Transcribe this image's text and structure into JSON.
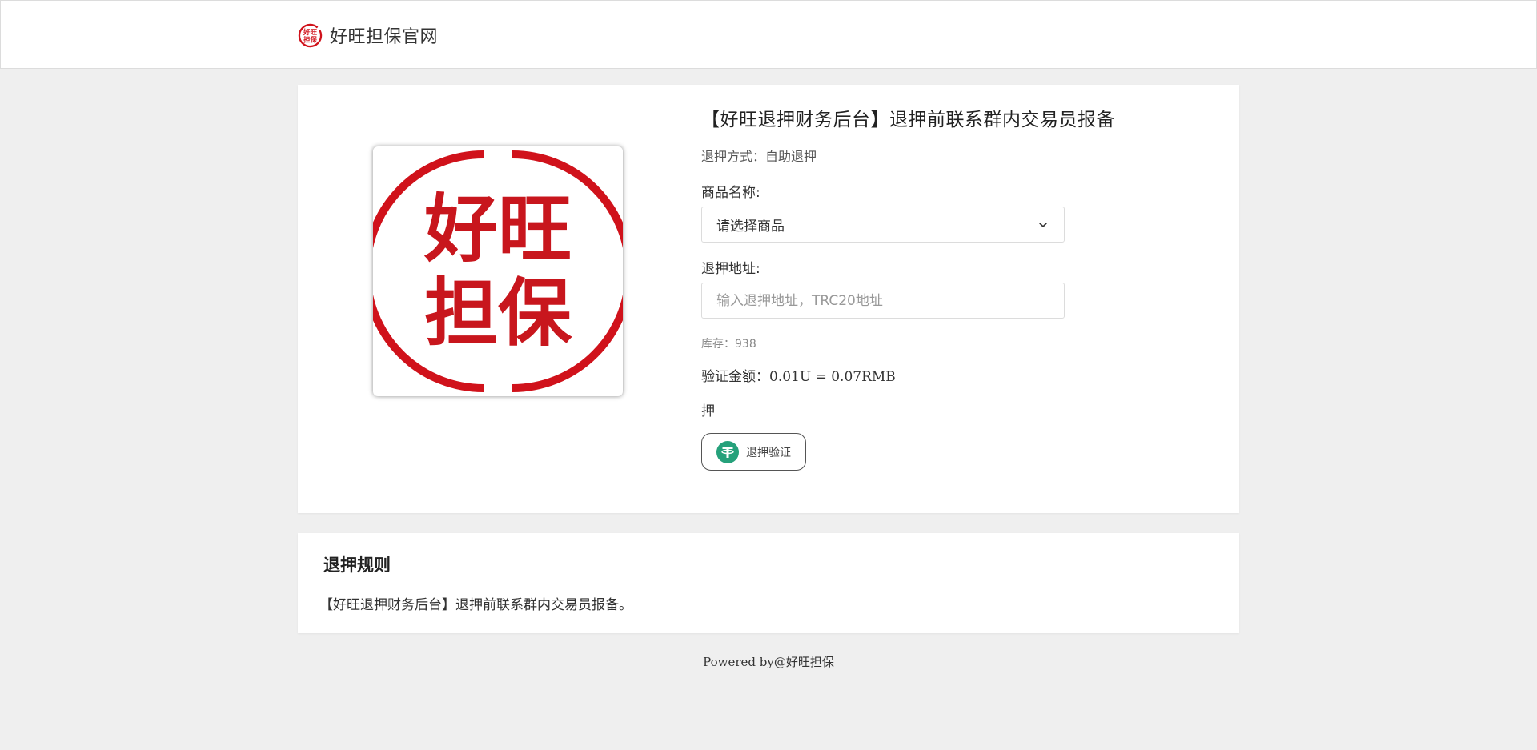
{
  "header": {
    "brand_name": "好旺担保官网",
    "logo_text": "好旺担保",
    "logo_icon": "haowang-seal-icon"
  },
  "product": {
    "image_text_line1": "好旺",
    "image_text_line2": "担保",
    "title": "【好旺退押财务后台】退押前联系群内交易员报备",
    "method_label": "退押方式：",
    "method_value": "自助退押",
    "name_label": "商品名称:",
    "select_value": "请选择商品",
    "address_label": "退押地址:",
    "address_placeholder": "输入退押地址，TRC20地址",
    "address_value": "",
    "stock_text": "库存：938",
    "verify_label": "验证金额：",
    "verify_value": "0.01U = 0.07RMB",
    "deposit_char": "押",
    "verify_button_label": "退押验证",
    "verify_button_icon": "tether-icon"
  },
  "rules": {
    "title": "退押规则",
    "text": "【好旺退押财务后台】退押前联系群内交易员报备。"
  },
  "footer": {
    "text": "Powered by@好旺担保"
  },
  "colors": {
    "brand_red": "#d0121b",
    "tether_green": "#26a17b",
    "page_bg": "#efefef"
  }
}
